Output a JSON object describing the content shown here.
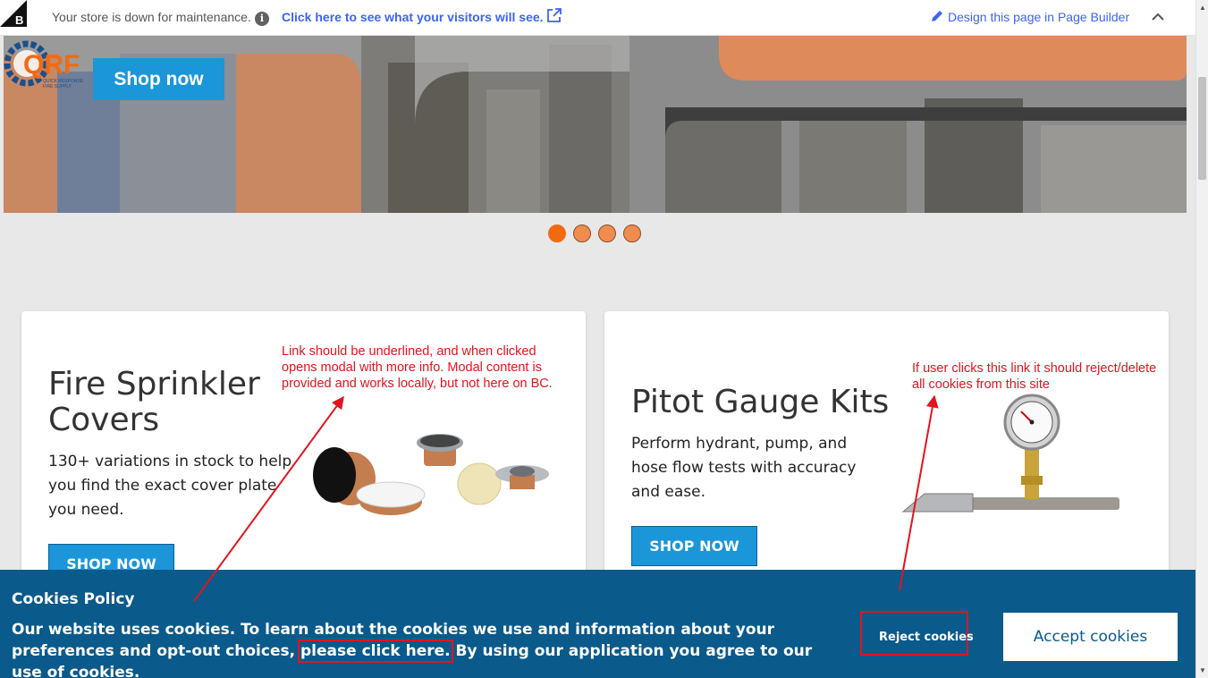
{
  "topbar": {
    "maintenance_text": "Your store is down for maintenance.",
    "preview_link": "Click here to see what your visitors will see.",
    "page_builder_link": "Design this page in Page Builder"
  },
  "hero": {
    "shop_now_label": "Shop now",
    "logo_text": "QRF",
    "logo_subtext": "QUICK RESPONSE FIRE SUPPLY",
    "slide_count": 4,
    "active_slide": 1
  },
  "cards": [
    {
      "title_line1": "Fire Sprinkler",
      "title_line2": "Covers",
      "desc_line1": "130+ variations in stock to help",
      "desc_line2": "you find the exact cover plate",
      "desc_line3": "you need.",
      "button_label": "SHOP NOW"
    },
    {
      "title": "Pitot Gauge Kits",
      "desc_line1": "Perform hydrant, pump, and",
      "desc_line2": "hose flow tests with accuracy",
      "desc_line3": "and ease.",
      "button_label": "SHOP NOW"
    }
  ],
  "annotations": {
    "left_line1": "Link should be underlined, and when clicked",
    "left_line2": "opens modal with more info. Modal content is",
    "left_line3": "provided and works locally, but not here on BC.",
    "right_line1": "If user clicks this link it should reject/delete",
    "right_line2": "all cookies from this site"
  },
  "cookie_banner": {
    "title": "Cookies Policy",
    "text_line1": "Our website uses cookies. To learn about the cookies we use and information about your preferences and opt-out",
    "text_prefix": "choices, ",
    "link_text": "please click here.",
    "text_suffix": " By using our application you agree to our use of cookies.",
    "reject_label": "Reject cookies",
    "accept_label": "Accept cookies"
  },
  "colors": {
    "accent_blue": "#1b96d8",
    "banner_blue": "#0a5a8b",
    "annotation_red": "#e2141e",
    "dot_orange": "#f16a12",
    "link_blue": "#3c64f4"
  }
}
